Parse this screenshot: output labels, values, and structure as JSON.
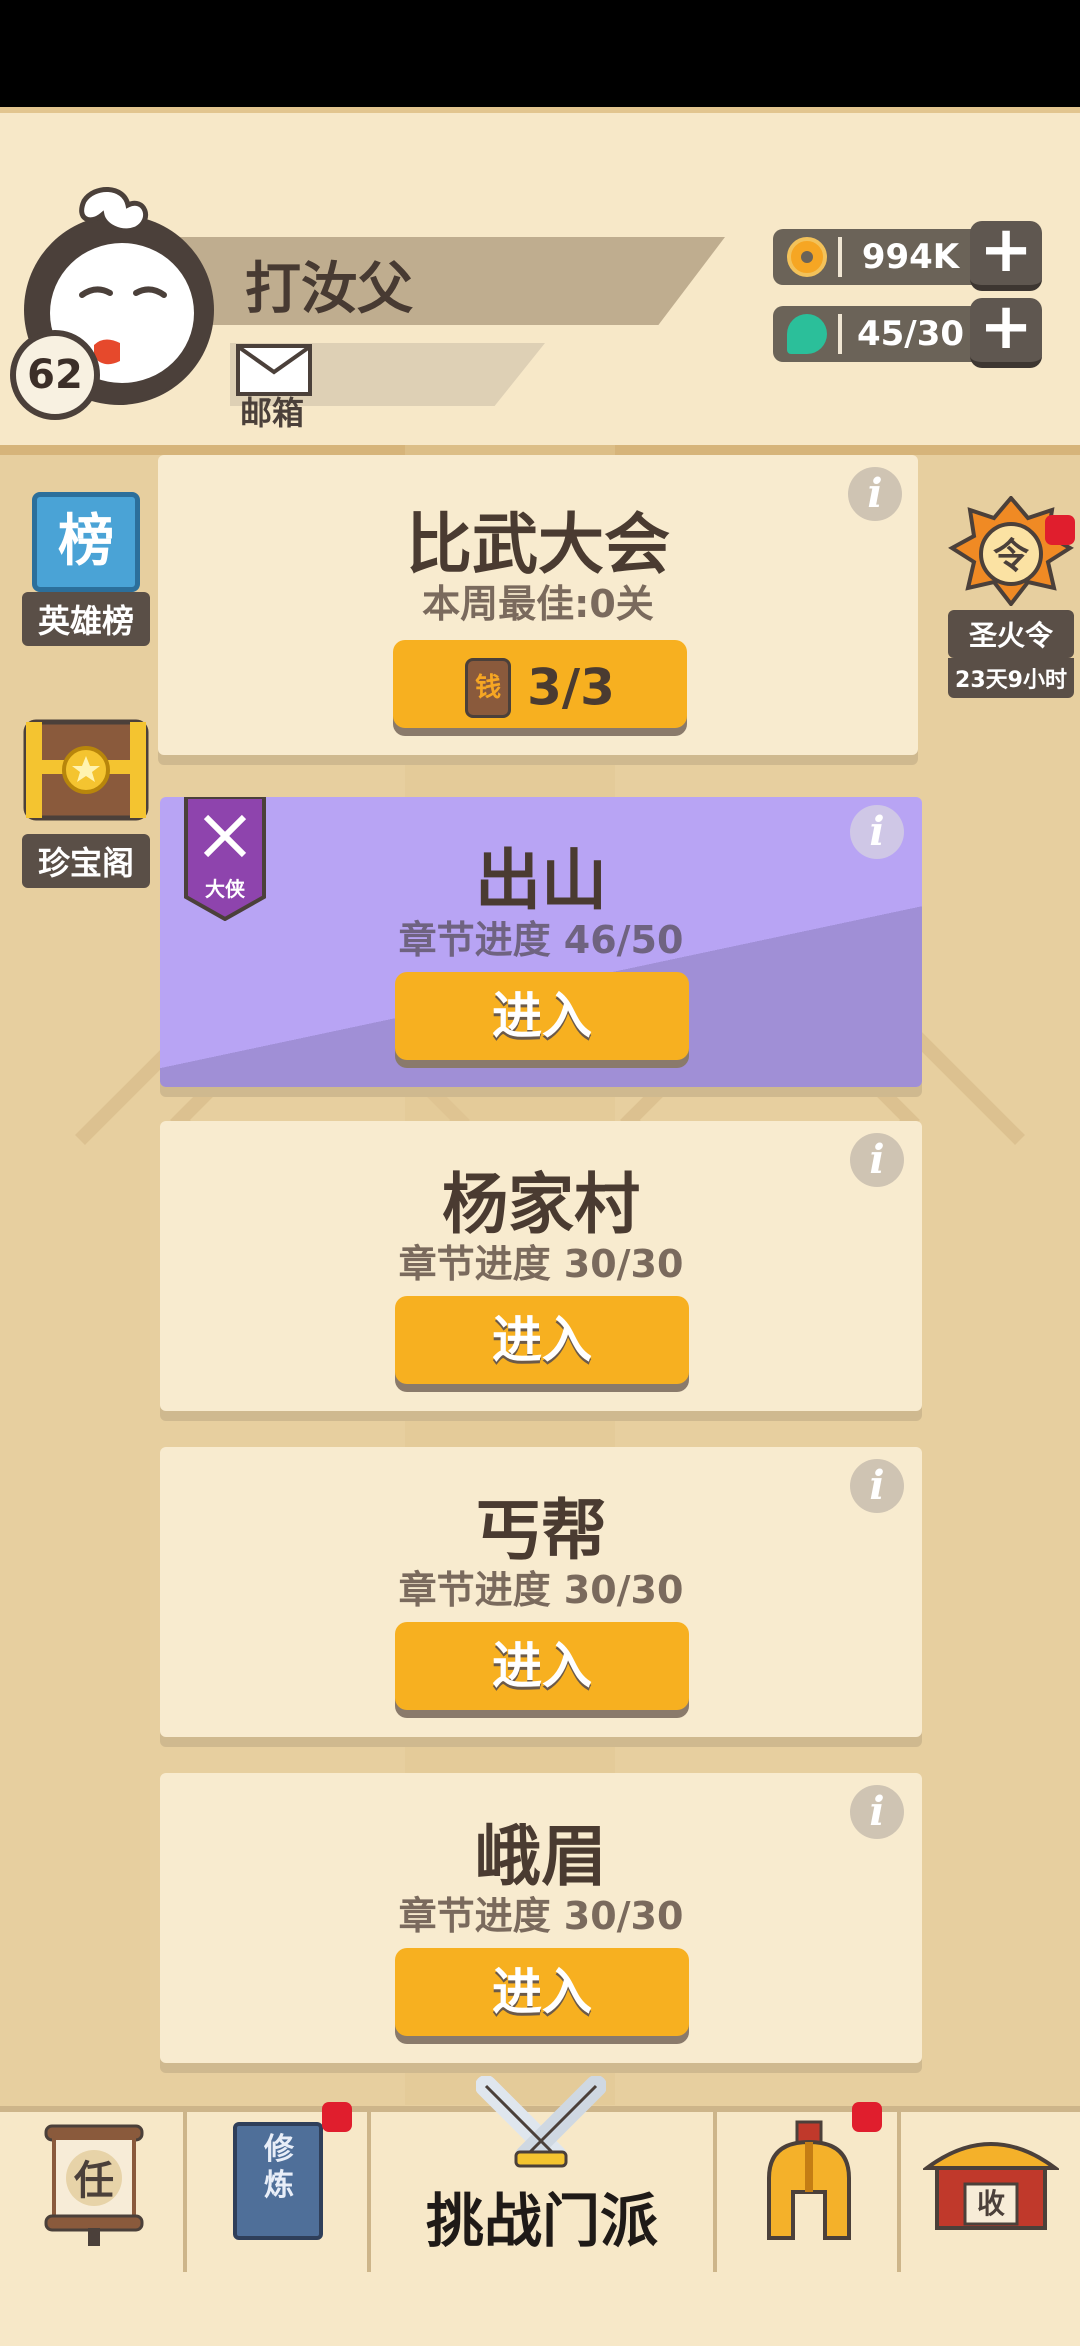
{
  "profile": {
    "level": "62",
    "name": "打汝父",
    "mail_label": "邮箱"
  },
  "currencies": [
    {
      "value": "994K",
      "icon": "coin-icon",
      "color": "#f6a623"
    },
    {
      "value": "45/30",
      "icon": "gem-icon",
      "color": "#2bbf9a"
    }
  ],
  "side_left": [
    {
      "label": "英雄榜",
      "glyph": "榜"
    },
    {
      "label": "珍宝阁",
      "glyph": ""
    }
  ],
  "side_right": {
    "label": "圣火令",
    "glyph": "令",
    "timer": "23天9小时"
  },
  "cards": {
    "tournament": {
      "title": "比武大会",
      "subtitle": "本周最佳:0关",
      "button": "3/3",
      "ticket_glyph": "钱"
    },
    "chushan": {
      "title": "出山",
      "subtitle": "章节进度 46/50",
      "button": "进入",
      "badge": "大侠"
    },
    "yangjiacun": {
      "title": "杨家村",
      "subtitle": "章节进度 30/30",
      "button": "进入"
    },
    "gaibang": {
      "title": "丐帮",
      "subtitle": "章节进度 30/30",
      "button": "进入"
    },
    "emei": {
      "title": "峨眉",
      "subtitle": "章节进度 30/30",
      "button": "进入"
    }
  },
  "nav": {
    "task_glyph": "任",
    "cultivate_glyph": "修炼",
    "challenge_label": "挑战门派",
    "collect_glyph": "收"
  },
  "colors": {
    "accent_button": "#f7b020",
    "chushan_card": "#b7a3f2",
    "card_bg": "#f8ebcf",
    "notify_red": "#e01e2d"
  }
}
